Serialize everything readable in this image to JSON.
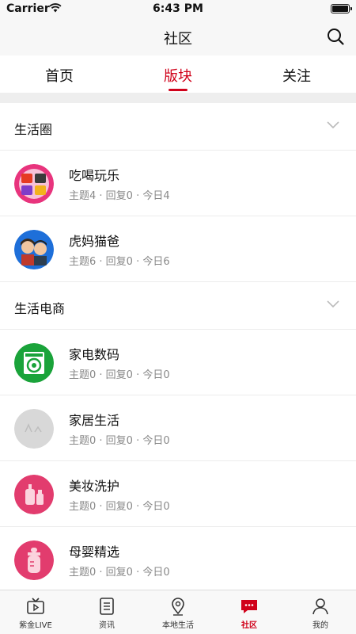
{
  "status_bar": {
    "carrier": "Carrier",
    "time": "6:43 PM"
  },
  "nav": {
    "title": "社区"
  },
  "tabs": [
    {
      "label": "首页",
      "active": false
    },
    {
      "label": "版块",
      "active": true
    },
    {
      "label": "关注",
      "active": false
    }
  ],
  "accent_color": "#d0021b",
  "sections": [
    {
      "title": "生活圈",
      "items": [
        {
          "name": "吃喝玩乐",
          "stats": "主题4 · 回复0 · 今日4",
          "icon": "food-fun-icon"
        },
        {
          "name": "虎妈猫爸",
          "stats": "主题6 · 回复0 · 今日6",
          "icon": "parents-icon"
        }
      ]
    },
    {
      "title": "生活电商",
      "items": [
        {
          "name": "家电数码",
          "stats": "主题0 · 回复0 · 今日0",
          "icon": "washing-machine-icon"
        },
        {
          "name": "家居生活",
          "stats": "主题0 · 回复0 · 今日0",
          "icon": "home-life-icon"
        },
        {
          "name": "美妆洗护",
          "stats": "主题0 · 回复0 · 今日0",
          "icon": "cosmetics-icon"
        },
        {
          "name": "母婴精选",
          "stats": "主题0 · 回复0 · 今日0",
          "icon": "baby-bottle-icon"
        }
      ]
    }
  ],
  "tabbar": [
    {
      "label": "紫金LIVE",
      "icon": "tv-icon",
      "active": false
    },
    {
      "label": "资讯",
      "icon": "news-list-icon",
      "active": false
    },
    {
      "label": "本地生活",
      "icon": "map-pin-icon",
      "active": false
    },
    {
      "label": "社区",
      "icon": "chat-bubble-icon",
      "active": true
    },
    {
      "label": "我的",
      "icon": "person-icon",
      "active": false
    }
  ]
}
